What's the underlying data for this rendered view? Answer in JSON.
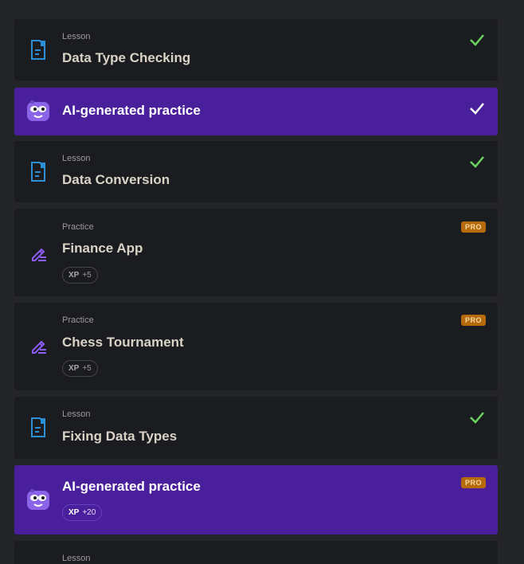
{
  "items": [
    {
      "kind": "Lesson",
      "title": "Data Type Checking",
      "icon": "document-icon",
      "status": "completed"
    },
    {
      "kind": "",
      "title": "AI-generated practice",
      "icon": "ai-mascot-icon",
      "status": "completed"
    },
    {
      "kind": "Lesson",
      "title": "Data Conversion",
      "icon": "document-icon",
      "status": "completed"
    },
    {
      "kind": "Practice",
      "title": "Finance App",
      "icon": "pencil-icon",
      "badge": "PRO",
      "xp_label": "XP",
      "xp_value": "+5"
    },
    {
      "kind": "Practice",
      "title": "Chess Tournament",
      "icon": "pencil-icon",
      "badge": "PRO",
      "xp_label": "XP",
      "xp_value": "+5"
    },
    {
      "kind": "Lesson",
      "title": "Fixing Data Types",
      "icon": "document-icon",
      "status": "completed"
    },
    {
      "kind": "",
      "title": "AI-generated practice",
      "icon": "ai-mascot-icon",
      "badge": "PRO",
      "xp_label": "XP",
      "xp_value": "+20"
    },
    {
      "kind": "Lesson",
      "title": "",
      "icon": "document-icon"
    }
  ],
  "colors": {
    "background": "#242528",
    "card": "#1b1c1f",
    "ai_card": "#4a1f9b",
    "check_green": "#6bd35f",
    "pro_badge": "#b56b0c",
    "doc_icon": "#2a8fd6",
    "pencil_icon": "#8b5cf6"
  }
}
